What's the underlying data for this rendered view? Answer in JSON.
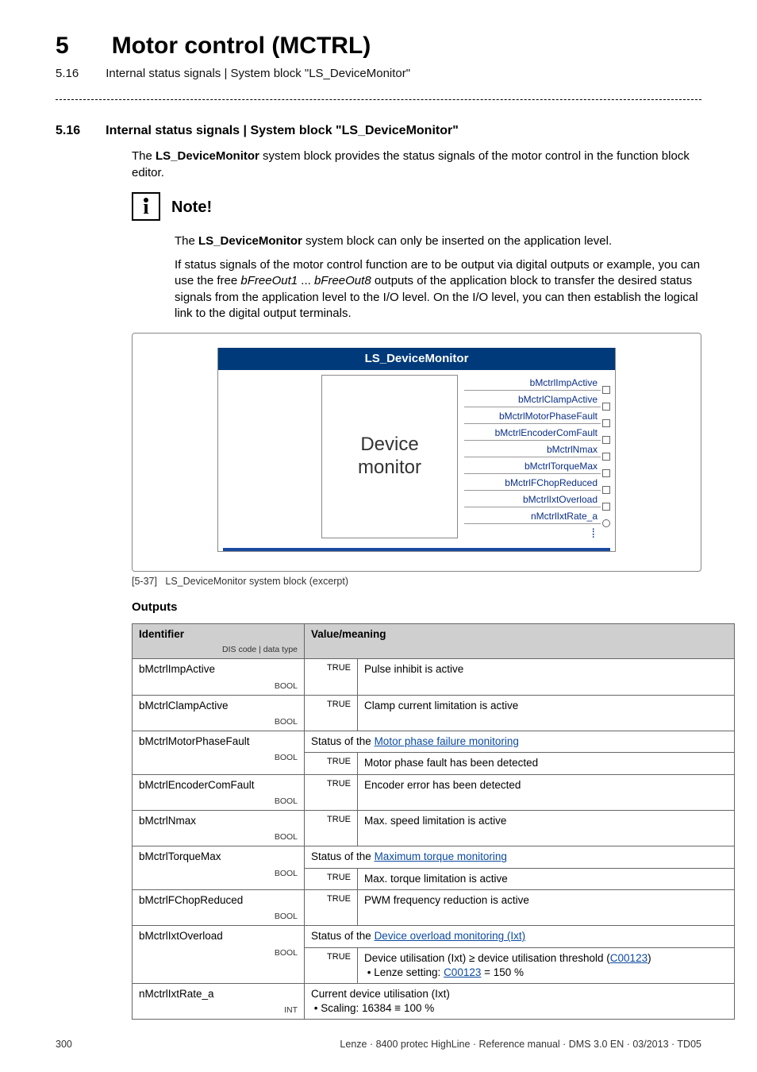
{
  "chapter": {
    "num": "5",
    "title": "Motor control (MCTRL)"
  },
  "subchapter": {
    "num": "5.16",
    "title": "Internal status signals | System block \"LS_DeviceMonitor\""
  },
  "section": {
    "num": "5.16",
    "title": "Internal status signals | System block \"LS_DeviceMonitor\""
  },
  "intro": "The LS_DeviceMonitor system block provides the status signals of the motor control in the function block editor.",
  "intro_prefix": "The ",
  "intro_bold": "LS_DeviceMonitor",
  "intro_rest": " system block provides the status signals of the motor control in the function block editor.",
  "note": {
    "title": "Note!",
    "p1_prefix": "The ",
    "p1_bold": "LS_DeviceMonitor",
    "p1_rest": " system block can only be inserted on the application level.",
    "p2_a": "If status signals of the motor control function are to be output via digital outputs or example, you can use the free ",
    "p2_i1": "bFreeOut1",
    "p2_mid": " ... ",
    "p2_i2": "bFreeOut8",
    "p2_b": " outputs of the application block to transfer the desired status signals from the application level to the I/O level. On the I/O level, you can then establish the logical link to the digital output terminals."
  },
  "diagram": {
    "title": "LS_DeviceMonitor",
    "box_l1": "Device",
    "box_l2": "monitor",
    "signals": [
      "bMctrlImpActive",
      "bMctrlClampActive",
      "bMctrlMotorPhaseFault",
      "bMctrlEncoderComFault",
      "bMctrlNmax",
      "bMctrlTorqueMax",
      "bMctrlFChopReduced",
      "bMctrlIxtOverload",
      "nMctrlIxtRate_a"
    ],
    "caption_tag": "[5-37]",
    "caption_text": "LS_DeviceMonitor system block (excerpt)"
  },
  "outputs": {
    "title": "Outputs",
    "head_id": "Identifier",
    "head_sub": "DIS code | data type",
    "head_val": "Value/meaning",
    "true": "TRUE",
    "rows": {
      "r1": {
        "id": "bMctrlImpActive",
        "dt": "BOOL",
        "val": "Pulse inhibit is active"
      },
      "r2": {
        "id": "bMctrlClampActive",
        "dt": "BOOL",
        "val": "Clamp current limitation is active"
      },
      "r3": {
        "id": "bMctrlMotorPhaseFault",
        "dt": "BOOL",
        "status_pre": "Status of the ",
        "status_link": "Motor phase failure monitoring",
        "val": "Motor phase fault has been detected"
      },
      "r4": {
        "id": "bMctrlEncoderComFault",
        "dt": "BOOL",
        "val": "Encoder error has been detected"
      },
      "r5": {
        "id": "bMctrlNmax",
        "dt": "BOOL",
        "val": "Max. speed limitation is active"
      },
      "r6": {
        "id": "bMctrlTorqueMax",
        "dt": "BOOL",
        "status_pre": "Status of the ",
        "status_link": "Maximum torque monitoring",
        "val": "Max. torque limitation is active"
      },
      "r7": {
        "id": "bMctrlFChopReduced",
        "dt": "BOOL",
        "val": "PWM frequency reduction is active"
      },
      "r8": {
        "id": "bMctrlIxtOverload",
        "dt": "BOOL",
        "status_pre": "Status of the ",
        "status_link": "Device overload monitoring (Ixt)",
        "val_pre": "Device utilisation (Ixt) ≥ device utilisation threshold (",
        "val_link": "C00123",
        "val_post": ")",
        "bullet_pre": "• Lenze setting:  ",
        "bullet_link": "C00123",
        "bullet_post": " = 150 %"
      },
      "r9": {
        "id": "nMctrlIxtRate_a",
        "dt": "INT",
        "line1": "Current device utilisation (Ixt)",
        "line2": "• Scaling: 16384 ≡ 100 %"
      }
    }
  },
  "footer": {
    "page": "300",
    "right": "Lenze · 8400 protec HighLine · Reference manual · DMS 3.0 EN · 03/2013 · TD05"
  }
}
